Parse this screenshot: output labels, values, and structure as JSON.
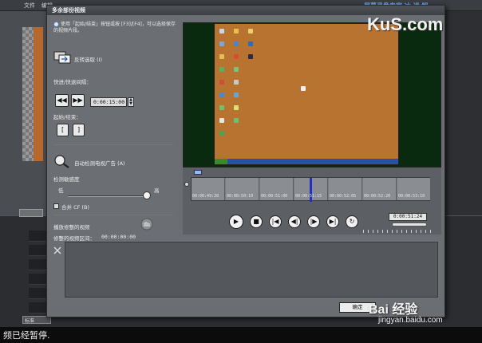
{
  "background_app": {
    "menu": [
      "文件",
      "编辑"
    ],
    "brand": "屏幕录像专家 冰 讲 解",
    "bottom_tab": "标准"
  },
  "dialog": {
    "title": "多余部份视频",
    "hint": "使用「起始/结束」按钮或按 [F3]/[F4]，可以选择保存的视频片段。",
    "reverse_select": "反转选取 (I)",
    "jump_interval_label": "快进/快退间隔：",
    "jump_interval_value": "0:00:15:00",
    "start_end_label": "起始/结束：",
    "start_btn": "[",
    "end_btn": "]",
    "auto_detect": "自动检测电视广告 (A)",
    "sensitivity_label": "检测敏感度",
    "sensitivity_low": "低",
    "sensitivity_high": "高",
    "merge_cf": "合并 CF (B)",
    "keep_clips_label": "播放修整的视频",
    "keep_range_label": "修整的视频区间：",
    "keep_range_value": "00:00:00:00",
    "ok_button": "确定"
  },
  "timeline": {
    "ticks": [
      "00:00:49:20",
      "00:00:50:10",
      "00:00:51:00",
      "00:00:51:15",
      "00:00:52:05",
      "00:00:52:20",
      "00:00:53:10"
    ],
    "current_time": "0:00:51:24",
    "playhead_fraction": 0.5
  },
  "controls": {
    "play": "▶",
    "stop": "■",
    "first": "|◀",
    "prev": "◀|",
    "next": "|▶",
    "last": "▶|",
    "loop": "↻"
  },
  "overlays": {
    "watermark": "KuS.com",
    "status": "频已经暂停.",
    "baidu": "Bai 经验",
    "baidu_url": "jingyan.baidu.com"
  }
}
